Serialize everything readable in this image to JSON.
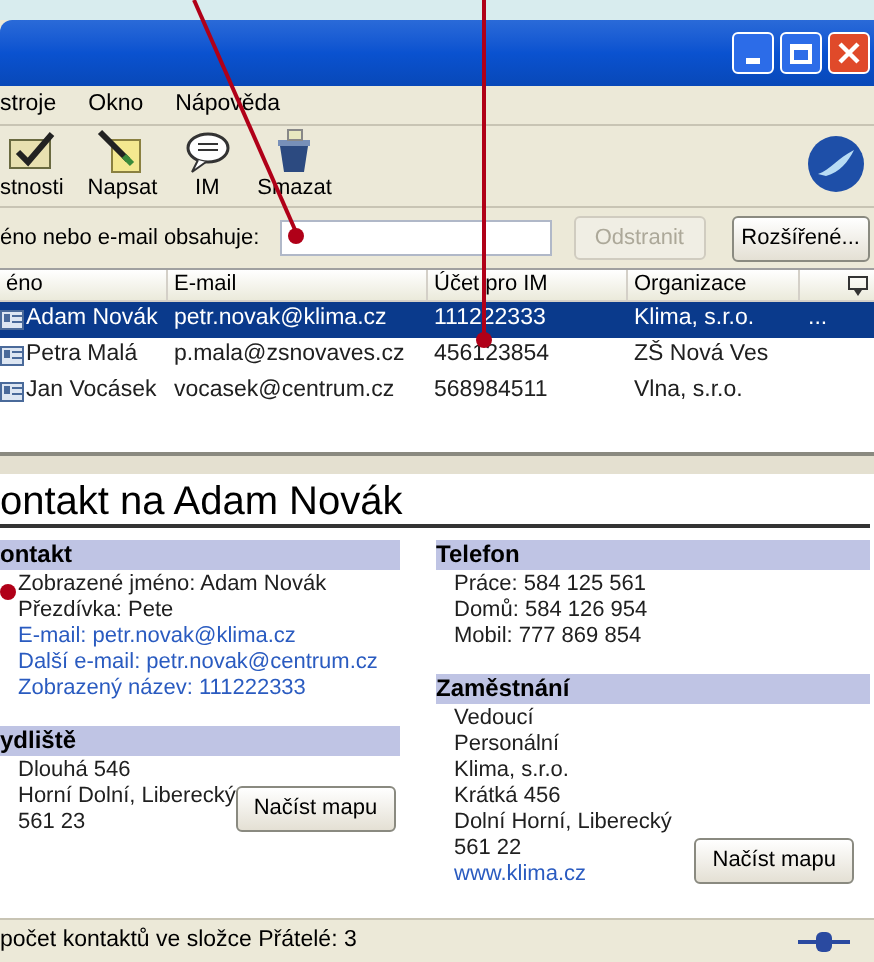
{
  "menu": [
    "stroje",
    "Okno",
    "Nápověda"
  ],
  "toolbar": [
    {
      "label": "stnosti",
      "kind": "properties"
    },
    {
      "label": "Napsat",
      "kind": "compose"
    },
    {
      "label": "IM",
      "kind": "im"
    },
    {
      "label": "Smazat",
      "kind": "delete"
    }
  ],
  "search": {
    "label": "éno nebo e-mail obsahuje:",
    "clear_button": {
      "label": "Odstranit",
      "disabled": true
    },
    "advanced_button": "Rozšířené..."
  },
  "table": {
    "columns": [
      "éno",
      "E-mail",
      "Účet pro IM",
      "Organizace"
    ],
    "rows": [
      {
        "name": "Adam Novák",
        "email": "petr.novak@klima.cz",
        "im": "111222333",
        "org": "Klima, s.r.o.",
        "extra": "...",
        "selected": true
      },
      {
        "name": "Petra Malá",
        "email": "p.mala@zsnovaves.cz",
        "im": "456123854",
        "org": "ZŠ Nová Ves",
        "selected": false
      },
      {
        "name": "Jan Vocásek",
        "email": "vocasek@centrum.cz",
        "im": "568984511",
        "org": "Vlna, s.r.o.",
        "selected": false
      }
    ]
  },
  "detail": {
    "title": "ontakt na Adam Novák",
    "left": [
      {
        "heading": "ontakt",
        "lines": [
          {
            "text": "Zobrazené jméno: Adam Novák",
            "link": false
          },
          {
            "text": "Přezdívka: Pete",
            "link": false
          },
          {
            "text": "E-mail: petr.novak@klima.cz",
            "link": true
          },
          {
            "text": "Další e-mail: petr.novak@centrum.cz",
            "link": true
          },
          {
            "text": "Zobrazený název: 111222333",
            "link": true
          }
        ]
      },
      {
        "heading": "ydliště",
        "lines": [
          {
            "text": "Dlouhá 546",
            "link": false
          },
          {
            "text": "Horní Dolní, Liberecký",
            "link": false
          },
          {
            "text": "561 23",
            "link": false
          }
        ],
        "map_button": "Načíst mapu"
      }
    ],
    "right": [
      {
        "heading": "Telefon",
        "lines": [
          {
            "text": "Práce: 584 125 561",
            "link": false
          },
          {
            "text": "Domů: 584 126 954",
            "link": false
          },
          {
            "text": "Mobil: 777 869 854",
            "link": false
          }
        ]
      },
      {
        "heading": "Zaměstnání",
        "lines": [
          {
            "text": "Vedoucí",
            "link": false
          },
          {
            "text": "Personální",
            "link": false
          },
          {
            "text": "Klima, s.r.o.",
            "link": false
          },
          {
            "text": "Krátká 456",
            "link": false
          },
          {
            "text": "Dolní Horní, Liberecký",
            "link": false
          },
          {
            "text": "561 22",
            "link": false
          },
          {
            "text": "www.klima.cz",
            "link": true
          }
        ],
        "map_button": "Načíst mapu"
      }
    ]
  },
  "status_bar": "počet kontaktů ve složce Přátelé: 3"
}
